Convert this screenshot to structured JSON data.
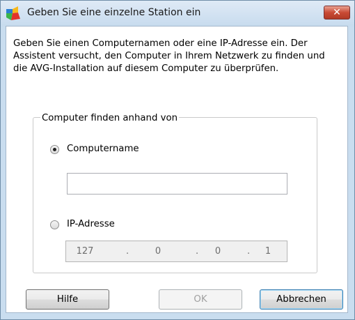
{
  "window": {
    "title": "Geben Sie eine einzelne Station ein",
    "close_label": "✕"
  },
  "intro_text": "Geben Sie einen Computernamen oder eine IP-Adresse ein. Der Assistent versucht, den Computer in Ihrem Netzwerk zu finden und die AVG-Installation auf diesem Computer zu überprüfen.",
  "group": {
    "legend": "Computer finden anhand von",
    "option_name": {
      "label": "Computername",
      "selected": true,
      "value": ""
    },
    "option_ip": {
      "label": "IP-Adresse",
      "selected": false,
      "octets": [
        "127",
        "0",
        "0",
        "1"
      ],
      "separator": "."
    }
  },
  "buttons": {
    "help": "Hilfe",
    "ok": "OK",
    "cancel": "Abbrechen"
  },
  "colors": {
    "title_bar": "#c9ddef",
    "close_button": "#c94a35"
  }
}
